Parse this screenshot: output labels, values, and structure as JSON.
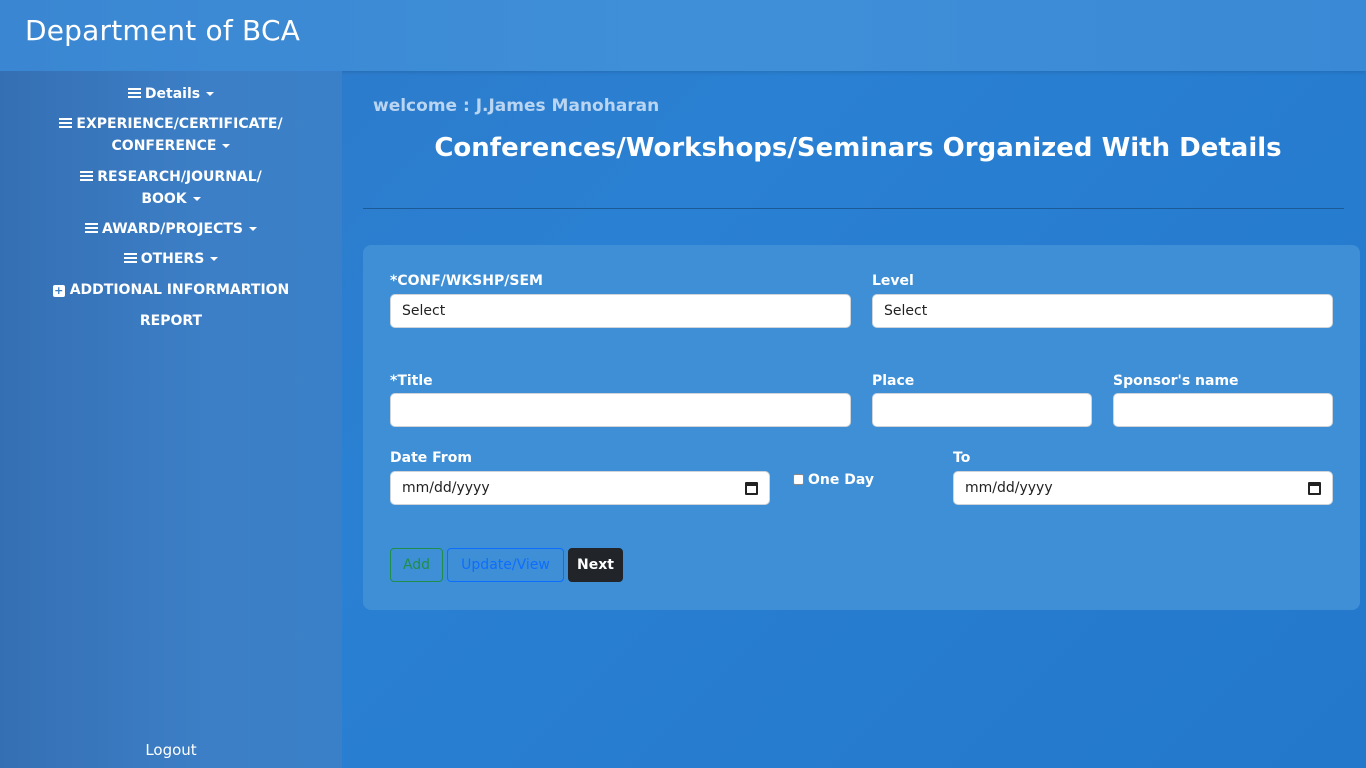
{
  "header": {
    "title": "Department of BCA"
  },
  "sidebar": {
    "items": [
      {
        "line1": "Details",
        "line2": "",
        "icon": "menu-icon",
        "dropdown": true
      },
      {
        "line1": "EXPERIENCE/CERTIFICATE/",
        "line2": "CONFERENCE",
        "icon": "menu-icon",
        "dropdown": true
      },
      {
        "line1": "RESEARCH/JOURNAL/",
        "line2": "BOOK",
        "icon": "menu-icon",
        "dropdown": true
      },
      {
        "line1": "AWARD/PROJECTS",
        "line2": "",
        "icon": "menu-icon",
        "dropdown": true
      },
      {
        "line1": "OTHERS",
        "line2": "",
        "icon": "menu-icon",
        "dropdown": true
      },
      {
        "line1": "ADDTIONAL INFORMARTION",
        "line2": "",
        "icon": "plus-square-icon",
        "dropdown": false
      },
      {
        "line1": "REPORT",
        "line2": "",
        "icon": "",
        "dropdown": false
      }
    ],
    "logout": "Logout"
  },
  "main": {
    "welcome": "welcome : J.James Manoharan",
    "title": "Conferences/Workshops/Seminars Organized With Details"
  },
  "form": {
    "type_label": "*CONF/WKSHP/SEM",
    "type_value": "Select",
    "level_label": "Level",
    "level_value": "Select",
    "title_label": "*Title",
    "title_value": "",
    "place_label": "Place",
    "place_value": "",
    "sponsor_label": "Sponsor's name",
    "sponsor_value": "",
    "date_from_label": "Date From",
    "date_from_value": "mm/dd/yyyy",
    "one_day_label": "One Day",
    "one_day_checked": false,
    "to_label": "To",
    "to_value": "mm/dd/yyyy"
  },
  "buttons": {
    "add": "Add",
    "update": "Update/View",
    "next": "Next"
  },
  "colors": {
    "add": "#1d8f4a",
    "update": "#0d6efd",
    "next": "#212529"
  }
}
